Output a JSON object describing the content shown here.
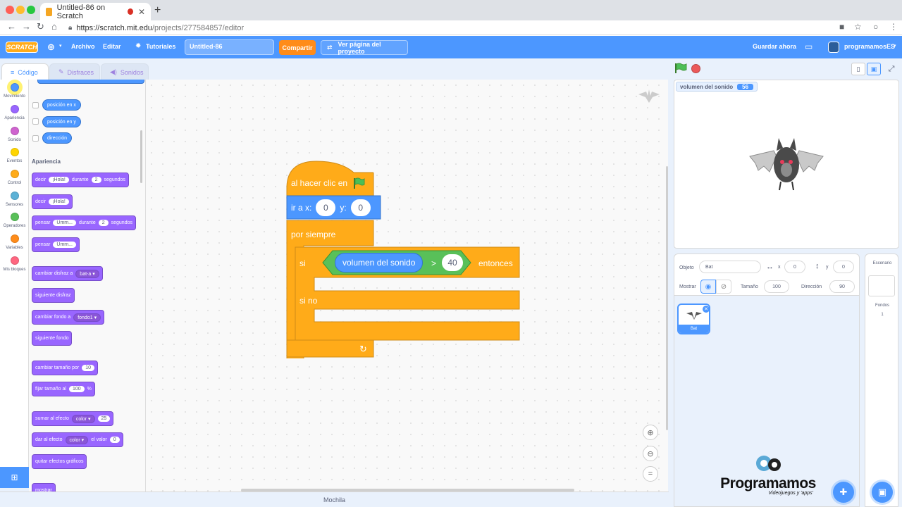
{
  "browser": {
    "tab_title": "Untitled-86 on Scratch",
    "new_tab_symbol": "+",
    "url_host": "https://scratch.mit.edu",
    "url_path": "/projects/277584857/editor"
  },
  "menubar": {
    "logo": "SCRATCH",
    "archivo": "Archivo",
    "editar": "Editar",
    "tutoriales": "Tutoriales",
    "project_title": "Untitled-86",
    "compartir": "Compartir",
    "ver_pagina": "Ver página del proyecto",
    "guardar": "Guardar ahora",
    "username": "programamosES"
  },
  "editor_tabs": {
    "code": "Código",
    "costumes": "Disfraces",
    "sounds": "Sonidos"
  },
  "categories": [
    {
      "label": "Movimiento",
      "color": "#4c97ff"
    },
    {
      "label": "Apariencia",
      "color": "#9966ff"
    },
    {
      "label": "Sonido",
      "color": "#cf63cf"
    },
    {
      "label": "Eventos",
      "color": "#ffd500"
    },
    {
      "label": "Control",
      "color": "#ffab19"
    },
    {
      "label": "Sensores",
      "color": "#5cb1d6"
    },
    {
      "label": "Operadores",
      "color": "#59c059"
    },
    {
      "label": "Variables",
      "color": "#ff8c1a"
    },
    {
      "label": "Mis bloques",
      "color": "#ff6680"
    }
  ],
  "palette": {
    "motion_reporters": [
      "posición en x",
      "posición en y",
      "dirección"
    ],
    "looks_title": "Apariencia",
    "decir": "decir",
    "hola": "¡Hola!",
    "durante": "durante",
    "segundos": "segundos",
    "dos": "2",
    "pensar": "pensar",
    "umm": "Umm...",
    "cambiar_disfraz": "cambiar disfraz a",
    "bat_a": "bat-a",
    "siguiente_disfraz": "siguiente disfraz",
    "cambiar_fondo": "cambiar fondo a",
    "fondo1": "fondo1",
    "siguiente_fondo": "siguiente fondo",
    "cambiar_tamano": "cambiar tamaño por",
    "diez": "10",
    "fijar_tamano": "fijar tamaño al",
    "cien": "100",
    "percent": "%",
    "sumar_efecto": "sumar al efecto",
    "color": "color",
    "veinticinco": "25",
    "dar_efecto": "dar al efecto",
    "el_valor": "el valor",
    "cero": "0",
    "quitar_efectos": "quitar efectos gráficos",
    "mostrar": "mostrar"
  },
  "script": {
    "hat": "al hacer clic en",
    "goto_label_x": "ir a x:",
    "goto_x": "0",
    "goto_label_y": "y:",
    "goto_y": "0",
    "forever": "por siempre",
    "if": "si",
    "reporter": "volumen del sonido",
    "op": ">",
    "threshold": "40",
    "then": "entonces",
    "else": "si no"
  },
  "backpack": "Mochila",
  "stage": {
    "monitor_label": "volumen del sonido",
    "monitor_value": "56"
  },
  "sprite_info": {
    "objeto_label": "Objeto",
    "sprite_name": "Bat",
    "x_label": "x",
    "x_value": "0",
    "y_label": "y",
    "y_value": "0",
    "mostrar_label": "Mostrar",
    "tamano_label": "Tamaño",
    "tamano_value": "100",
    "direccion_label": "Dirección",
    "direccion_value": "90"
  },
  "sprite_list": [
    {
      "name": "Bat"
    }
  ],
  "stage_panel": {
    "title": "Escenario",
    "fondos_label": "Fondos",
    "fondos_count": "1"
  },
  "brand": {
    "name": "Programamos",
    "tagline": "Videojuegos y 'apps'"
  }
}
